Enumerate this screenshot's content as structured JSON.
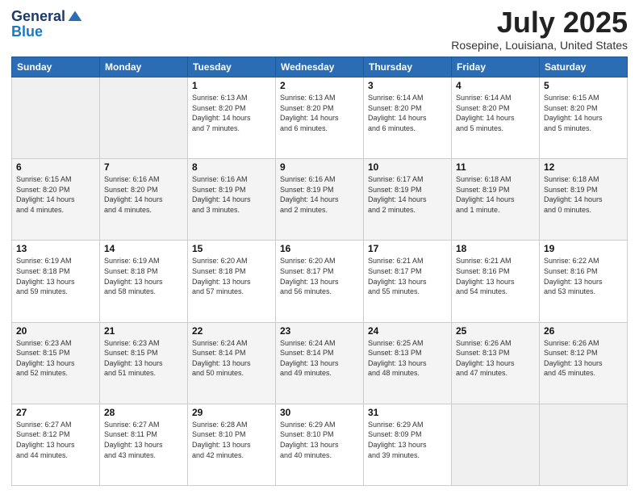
{
  "header": {
    "logo_general": "General",
    "logo_blue": "Blue",
    "month_title": "July 2025",
    "location": "Rosepine, Louisiana, United States"
  },
  "weekdays": [
    "Sunday",
    "Monday",
    "Tuesday",
    "Wednesday",
    "Thursday",
    "Friday",
    "Saturday"
  ],
  "weeks": [
    [
      {
        "day": "",
        "info": ""
      },
      {
        "day": "",
        "info": ""
      },
      {
        "day": "1",
        "info": "Sunrise: 6:13 AM\nSunset: 8:20 PM\nDaylight: 14 hours\nand 7 minutes."
      },
      {
        "day": "2",
        "info": "Sunrise: 6:13 AM\nSunset: 8:20 PM\nDaylight: 14 hours\nand 6 minutes."
      },
      {
        "day": "3",
        "info": "Sunrise: 6:14 AM\nSunset: 8:20 PM\nDaylight: 14 hours\nand 6 minutes."
      },
      {
        "day": "4",
        "info": "Sunrise: 6:14 AM\nSunset: 8:20 PM\nDaylight: 14 hours\nand 5 minutes."
      },
      {
        "day": "5",
        "info": "Sunrise: 6:15 AM\nSunset: 8:20 PM\nDaylight: 14 hours\nand 5 minutes."
      }
    ],
    [
      {
        "day": "6",
        "info": "Sunrise: 6:15 AM\nSunset: 8:20 PM\nDaylight: 14 hours\nand 4 minutes."
      },
      {
        "day": "7",
        "info": "Sunrise: 6:16 AM\nSunset: 8:20 PM\nDaylight: 14 hours\nand 4 minutes."
      },
      {
        "day": "8",
        "info": "Sunrise: 6:16 AM\nSunset: 8:19 PM\nDaylight: 14 hours\nand 3 minutes."
      },
      {
        "day": "9",
        "info": "Sunrise: 6:16 AM\nSunset: 8:19 PM\nDaylight: 14 hours\nand 2 minutes."
      },
      {
        "day": "10",
        "info": "Sunrise: 6:17 AM\nSunset: 8:19 PM\nDaylight: 14 hours\nand 2 minutes."
      },
      {
        "day": "11",
        "info": "Sunrise: 6:18 AM\nSunset: 8:19 PM\nDaylight: 14 hours\nand 1 minute."
      },
      {
        "day": "12",
        "info": "Sunrise: 6:18 AM\nSunset: 8:19 PM\nDaylight: 14 hours\nand 0 minutes."
      }
    ],
    [
      {
        "day": "13",
        "info": "Sunrise: 6:19 AM\nSunset: 8:18 PM\nDaylight: 13 hours\nand 59 minutes."
      },
      {
        "day": "14",
        "info": "Sunrise: 6:19 AM\nSunset: 8:18 PM\nDaylight: 13 hours\nand 58 minutes."
      },
      {
        "day": "15",
        "info": "Sunrise: 6:20 AM\nSunset: 8:18 PM\nDaylight: 13 hours\nand 57 minutes."
      },
      {
        "day": "16",
        "info": "Sunrise: 6:20 AM\nSunset: 8:17 PM\nDaylight: 13 hours\nand 56 minutes."
      },
      {
        "day": "17",
        "info": "Sunrise: 6:21 AM\nSunset: 8:17 PM\nDaylight: 13 hours\nand 55 minutes."
      },
      {
        "day": "18",
        "info": "Sunrise: 6:21 AM\nSunset: 8:16 PM\nDaylight: 13 hours\nand 54 minutes."
      },
      {
        "day": "19",
        "info": "Sunrise: 6:22 AM\nSunset: 8:16 PM\nDaylight: 13 hours\nand 53 minutes."
      }
    ],
    [
      {
        "day": "20",
        "info": "Sunrise: 6:23 AM\nSunset: 8:15 PM\nDaylight: 13 hours\nand 52 minutes."
      },
      {
        "day": "21",
        "info": "Sunrise: 6:23 AM\nSunset: 8:15 PM\nDaylight: 13 hours\nand 51 minutes."
      },
      {
        "day": "22",
        "info": "Sunrise: 6:24 AM\nSunset: 8:14 PM\nDaylight: 13 hours\nand 50 minutes."
      },
      {
        "day": "23",
        "info": "Sunrise: 6:24 AM\nSunset: 8:14 PM\nDaylight: 13 hours\nand 49 minutes."
      },
      {
        "day": "24",
        "info": "Sunrise: 6:25 AM\nSunset: 8:13 PM\nDaylight: 13 hours\nand 48 minutes."
      },
      {
        "day": "25",
        "info": "Sunrise: 6:26 AM\nSunset: 8:13 PM\nDaylight: 13 hours\nand 47 minutes."
      },
      {
        "day": "26",
        "info": "Sunrise: 6:26 AM\nSunset: 8:12 PM\nDaylight: 13 hours\nand 45 minutes."
      }
    ],
    [
      {
        "day": "27",
        "info": "Sunrise: 6:27 AM\nSunset: 8:12 PM\nDaylight: 13 hours\nand 44 minutes."
      },
      {
        "day": "28",
        "info": "Sunrise: 6:27 AM\nSunset: 8:11 PM\nDaylight: 13 hours\nand 43 minutes."
      },
      {
        "day": "29",
        "info": "Sunrise: 6:28 AM\nSunset: 8:10 PM\nDaylight: 13 hours\nand 42 minutes."
      },
      {
        "day": "30",
        "info": "Sunrise: 6:29 AM\nSunset: 8:10 PM\nDaylight: 13 hours\nand 40 minutes."
      },
      {
        "day": "31",
        "info": "Sunrise: 6:29 AM\nSunset: 8:09 PM\nDaylight: 13 hours\nand 39 minutes."
      },
      {
        "day": "",
        "info": ""
      },
      {
        "day": "",
        "info": ""
      }
    ]
  ]
}
